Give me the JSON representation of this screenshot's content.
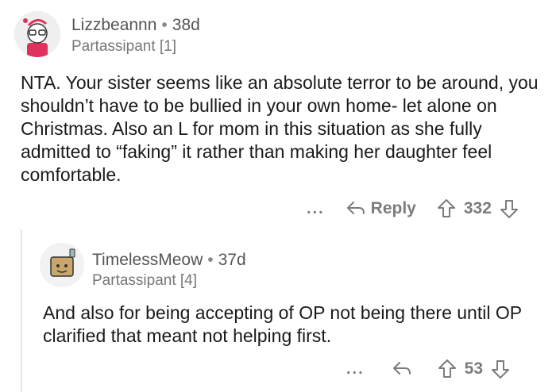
{
  "comments": [
    {
      "username": "Lizzbeannn",
      "age": "38d",
      "flair": "Partassipant [1]",
      "body": "NTA. Your sister seems like an absolute terror to be around, you shouldn’t have to be bullied in your own home- let alone on Christmas. Also an L for mom in this situation as she fully admitted to “faking” it rather than making her daughter feel comfortable.",
      "reply_label": "Reply",
      "score": "332",
      "more": "..."
    },
    {
      "username": "TimelessMeow",
      "age": "37d",
      "flair": "Partassipant [4]",
      "body": "And also for being accepting of OP not being there until OP clarified that meant not helping first.",
      "score": "53",
      "more": "..."
    }
  ],
  "colors": {
    "text": "#1a1a1b",
    "meta": "#7c7c7c",
    "avatar_accent": "#e0315c"
  }
}
